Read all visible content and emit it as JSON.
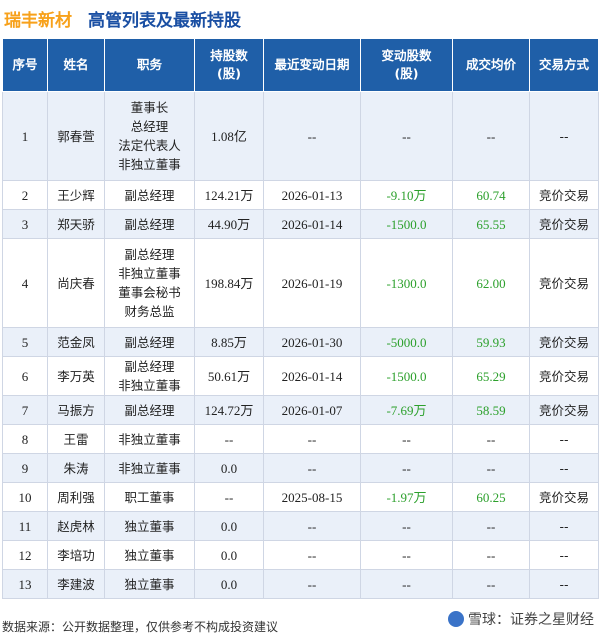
{
  "header": {
    "company": "瑞丰新材",
    "subtitle": "高管列表及最新持股"
  },
  "table": {
    "columns": [
      "序号",
      "姓名",
      "职务",
      "持股数\n(股)",
      "最近变动日期",
      "变动股数\n(股)",
      "成交均价",
      "交易方式"
    ],
    "rows": [
      {
        "no": "1",
        "name": "郭春萱",
        "role": "董事长\n总经理\n法定代表人\n非独立董事",
        "shares": "1.08亿",
        "date": "--",
        "change": "--",
        "price": "--",
        "method": "--"
      },
      {
        "no": "2",
        "name": "王少辉",
        "role": "副总经理",
        "shares": "124.21万",
        "date": "2026-01-13",
        "change": "-9.10万",
        "price": "60.74",
        "method": "竞价交易"
      },
      {
        "no": "3",
        "name": "郑天骄",
        "role": "副总经理",
        "shares": "44.90万",
        "date": "2026-01-14",
        "change": "-1500.0",
        "price": "65.55",
        "method": "竞价交易"
      },
      {
        "no": "4",
        "name": "尚庆春",
        "role": "副总经理\n非独立董事\n董事会秘书\n财务总监",
        "shares": "198.84万",
        "date": "2026-01-19",
        "change": "-1300.0",
        "price": "62.00",
        "method": "竞价交易"
      },
      {
        "no": "5",
        "name": "范金凤",
        "role": "副总经理",
        "shares": "8.85万",
        "date": "2026-01-30",
        "change": "-5000.0",
        "price": "59.93",
        "method": "竞价交易"
      },
      {
        "no": "6",
        "name": "李万英",
        "role": "副总经理\n非独立董事",
        "shares": "50.61万",
        "date": "2026-01-14",
        "change": "-1500.0",
        "price": "65.29",
        "method": "竞价交易"
      },
      {
        "no": "7",
        "name": "马振方",
        "role": "副总经理",
        "shares": "124.72万",
        "date": "2026-01-07",
        "change": "-7.69万",
        "price": "58.59",
        "method": "竞价交易"
      },
      {
        "no": "8",
        "name": "王雷",
        "role": "非独立董事",
        "shares": "--",
        "date": "--",
        "change": "--",
        "price": "--",
        "method": "--"
      },
      {
        "no": "9",
        "name": "朱涛",
        "role": "非独立董事",
        "shares": "0.0",
        "date": "--",
        "change": "--",
        "price": "--",
        "method": "--"
      },
      {
        "no": "10",
        "name": "周利强",
        "role": "职工董事",
        "shares": "--",
        "date": "2025-08-15",
        "change": "-1.97万",
        "price": "60.25",
        "method": "竞价交易"
      },
      {
        "no": "11",
        "name": "赵虎林",
        "role": "独立董事",
        "shares": "0.0",
        "date": "--",
        "change": "--",
        "price": "--",
        "method": "--"
      },
      {
        "no": "12",
        "name": "李培功",
        "role": "独立董事",
        "shares": "0.0",
        "date": "--",
        "change": "--",
        "price": "--",
        "method": "--"
      },
      {
        "no": "13",
        "name": "李建波",
        "role": "独立董事",
        "shares": "0.0",
        "date": "--",
        "change": "--",
        "price": "--",
        "method": "--"
      }
    ]
  },
  "footer": {
    "source": "数据来源：公开数据整理，仅供参考不构成投资建议",
    "brand": "雪球：证券之星财经"
  },
  "colors": {
    "header_bg": "#1f5fa8",
    "company": "#f7a11b",
    "subtitle": "#1a4fa3",
    "negative": "#2ca02c",
    "row_alt": "#eaf0f9"
  }
}
